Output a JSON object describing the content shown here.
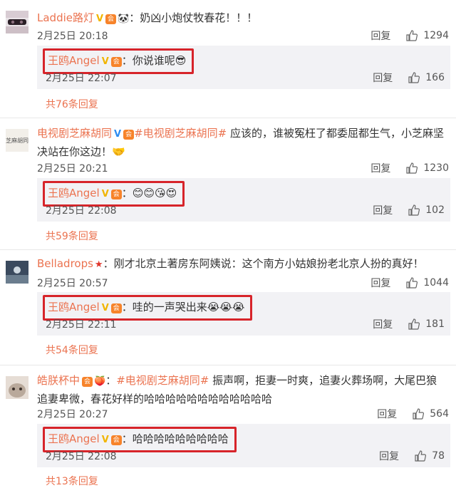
{
  "comments": [
    {
      "user": "Laddie路灯",
      "badge_v": "V",
      "badge_vip": "会",
      "badge_emoji": "🐼",
      "tag": "",
      "text": "：奶凶小炮仗牧春花！！！",
      "time": "2月25日 20:18",
      "reply_label": "回复",
      "likes": "1294",
      "reply": {
        "user": "王鸥Angel",
        "badge_v": "V",
        "badge_vip": "会",
        "text": "：你说谁呢",
        "emoji": "😎",
        "time": "2月25日 22:07",
        "reply_label": "回复",
        "likes": "166"
      },
      "more": "共76条回复"
    },
    {
      "user": "电视剧芝麻胡同",
      "badge_v": "V",
      "badge_vip": "会",
      "badge_emoji": "",
      "tag": "#电视剧芝麻胡同#",
      "text": "应该的，谁被冤枉了都委屈都生气，小芝麻坚决站在你这边！",
      "text_emoji": "🤝",
      "time": "2月25日 20:21",
      "reply_label": "回复",
      "likes": "1230",
      "reply": {
        "user": "王鸥Angel",
        "badge_v": "V",
        "badge_vip": "会",
        "text": "：",
        "emoji": "😊😊😘😍",
        "time": "2月25日 22:08",
        "reply_label": "回复",
        "likes": "102"
      },
      "more": "共59条回复"
    },
    {
      "user": "Belladrops",
      "badge_v": "",
      "badge_vip": "",
      "badge_emoji": "★",
      "tag": "",
      "text": "：刚才北京土著房东阿姨说：这个南方小姑娘扮老北京人扮的真好！",
      "time": "2月25日 20:57",
      "reply_label": "回复",
      "likes": "1044",
      "reply": {
        "user": "王鸥Angel",
        "badge_v": "V",
        "badge_vip": "会",
        "text": "：哇的一声哭出来",
        "emoji": "😭😭😭",
        "time": "2月25日 22:11",
        "reply_label": "回复",
        "likes": "181"
      },
      "more": "共54条回复"
    },
    {
      "user": "皓朕杯中",
      "badge_v": "",
      "badge_vip": "会",
      "badge_emoji": "🍑",
      "tag": "#电视剧芝麻胡同#",
      "text": "振声啊，拒妻一时爽，追妻火葬场啊，大尾巴狼追妻卑微，春花好样的哈哈哈哈哈哈哈哈哈哈哈哈",
      "time": "2月25日 20:27",
      "reply_label": "回复",
      "likes": "564",
      "reply": {
        "user": "王鸥Angel",
        "badge_v": "V",
        "badge_vip": "会",
        "text": "：哈哈哈哈哈哈哈哈哈",
        "emoji": "",
        "time": "2月25日 22:08",
        "reply_label": "回复",
        "likes": "78"
      },
      "more": "共13条回复"
    }
  ]
}
